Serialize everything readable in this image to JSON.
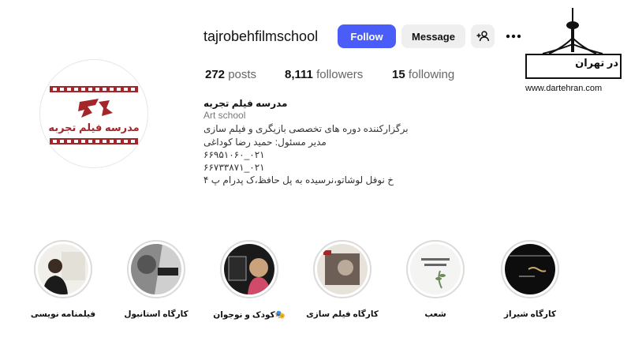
{
  "profile": {
    "username": "tajrobehfilmschool",
    "avatar_text": "مدرسه فیلم تجربه",
    "actions": {
      "follow": "Follow",
      "message": "Message"
    },
    "stats": {
      "posts_count": "272",
      "posts_label": "posts",
      "followers_count": "8,111",
      "followers_label": "followers",
      "following_count": "15",
      "following_label": "following"
    },
    "bio": {
      "name": "مدرسه فیلم تجربه",
      "category": "Art school",
      "lines": [
        "برگزارکننده دوره های تخصصی بازیگری و فیلم سازی",
        "مدیر مسئول: حمید رضا کوداغی",
        "۰۲۱_۶۶۹۵۱۰۶۰",
        "۰۲۱_۶۶۷۳۳۸۷۱",
        "خ نوفل لوشاتو،نرسیده به پل حافظ،ک پدرام پ ۴"
      ]
    }
  },
  "watermark": {
    "title": "در تهران",
    "url": "www.dartehran.com"
  },
  "highlights": [
    {
      "label": "فیلمنامه نویسی",
      "icon": "highlight-cover"
    },
    {
      "label": "کارگاه استانبول",
      "icon": "highlight-cover"
    },
    {
      "label": "🎭کودک و نوجوان",
      "icon": "highlight-cover"
    },
    {
      "label": "کارگاه فیلم سازی",
      "icon": "highlight-cover"
    },
    {
      "label": "شعب",
      "icon": "highlight-cover"
    },
    {
      "label": "کارگاه شیراز",
      "icon": "highlight-cover"
    }
  ],
  "colors": {
    "brand_red": "#a3262b",
    "follow_blue": "#4a5df9",
    "button_grey": "#efefef"
  }
}
